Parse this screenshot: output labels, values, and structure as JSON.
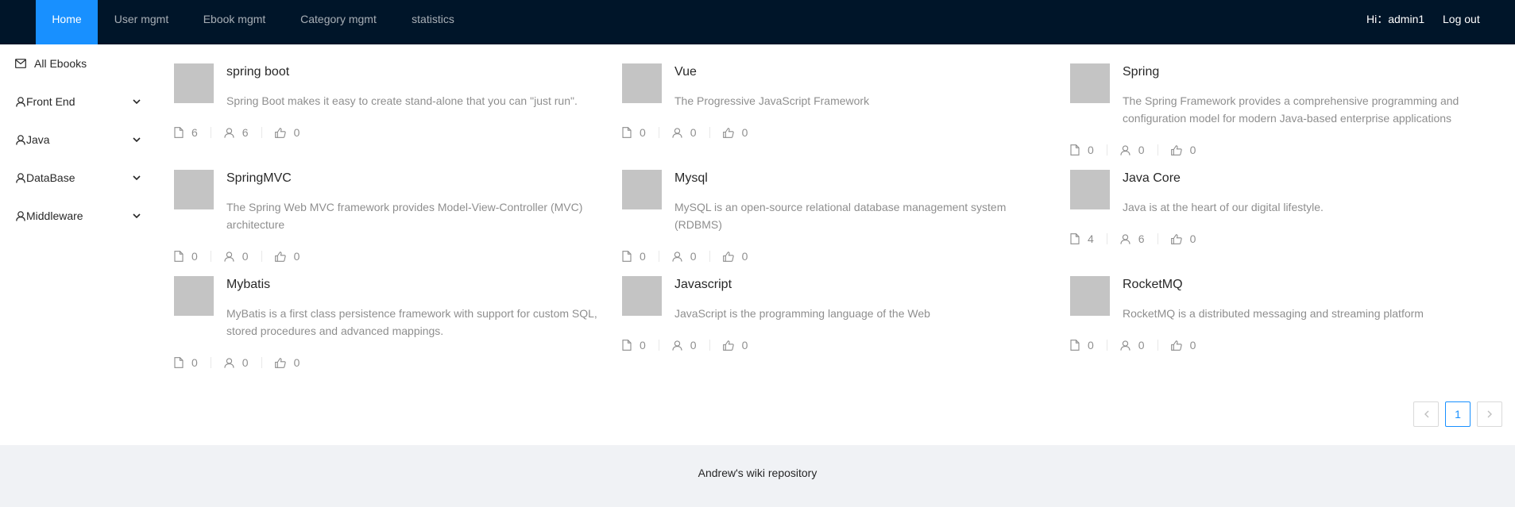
{
  "nav": {
    "items": [
      {
        "label": "Home",
        "active": true
      },
      {
        "label": "User mgmt"
      },
      {
        "label": "Ebook mgmt"
      },
      {
        "label": "Category mgmt"
      },
      {
        "label": "statistics"
      }
    ],
    "greeting": "Hi：admin1",
    "logout": "Log out"
  },
  "sidebar": {
    "items": [
      {
        "label": "All Ebooks",
        "icon": "mail-icon"
      },
      {
        "label": "Front End",
        "icon": "user-icon"
      },
      {
        "label": "Java",
        "icon": "user-icon"
      },
      {
        "label": "DataBase",
        "icon": "user-icon"
      },
      {
        "label": "Middleware",
        "icon": "user-icon"
      }
    ]
  },
  "ebooks": [
    {
      "title": "spring boot",
      "desc": "Spring Boot makes it easy to create stand-alone that you can \"just run\".",
      "docs": "6",
      "views": "6",
      "votes": "0"
    },
    {
      "title": "Vue",
      "desc": "The Progressive JavaScript Framework",
      "docs": "0",
      "views": "0",
      "votes": "0"
    },
    {
      "title": "Spring",
      "desc": "The Spring Framework provides a comprehensive programming and configuration model for modern Java-based enterprise applications",
      "docs": "0",
      "views": "0",
      "votes": "0"
    },
    {
      "title": "SpringMVC",
      "desc": "The Spring Web MVC framework provides Model-View-Controller (MVC) architecture",
      "docs": "0",
      "views": "0",
      "votes": "0"
    },
    {
      "title": "Mysql",
      "desc": "MySQL is an open-source relational database management system (RDBMS)",
      "docs": "0",
      "views": "0",
      "votes": "0"
    },
    {
      "title": "Java Core",
      "desc": "Java is at the heart of our digital lifestyle.",
      "docs": "4",
      "views": "6",
      "votes": "0"
    },
    {
      "title": "Mybatis",
      "desc": "MyBatis is a first class persistence framework with support for custom SQL, stored procedures and advanced mappings.",
      "docs": "0",
      "views": "0",
      "votes": "0"
    },
    {
      "title": "Javascript",
      "desc": "JavaScript is the programming language of the Web",
      "docs": "0",
      "views": "0",
      "votes": "0"
    },
    {
      "title": "RocketMQ",
      "desc": "RocketMQ is a distributed messaging and streaming platform",
      "docs": "0",
      "views": "0",
      "votes": "0"
    }
  ],
  "pagination": {
    "current": "1"
  },
  "footer": {
    "text": "Andrew's wiki repository"
  },
  "colors": {
    "header_bg": "#001529",
    "accent": "#1890ff",
    "footer_bg": "#f0f2f5"
  }
}
